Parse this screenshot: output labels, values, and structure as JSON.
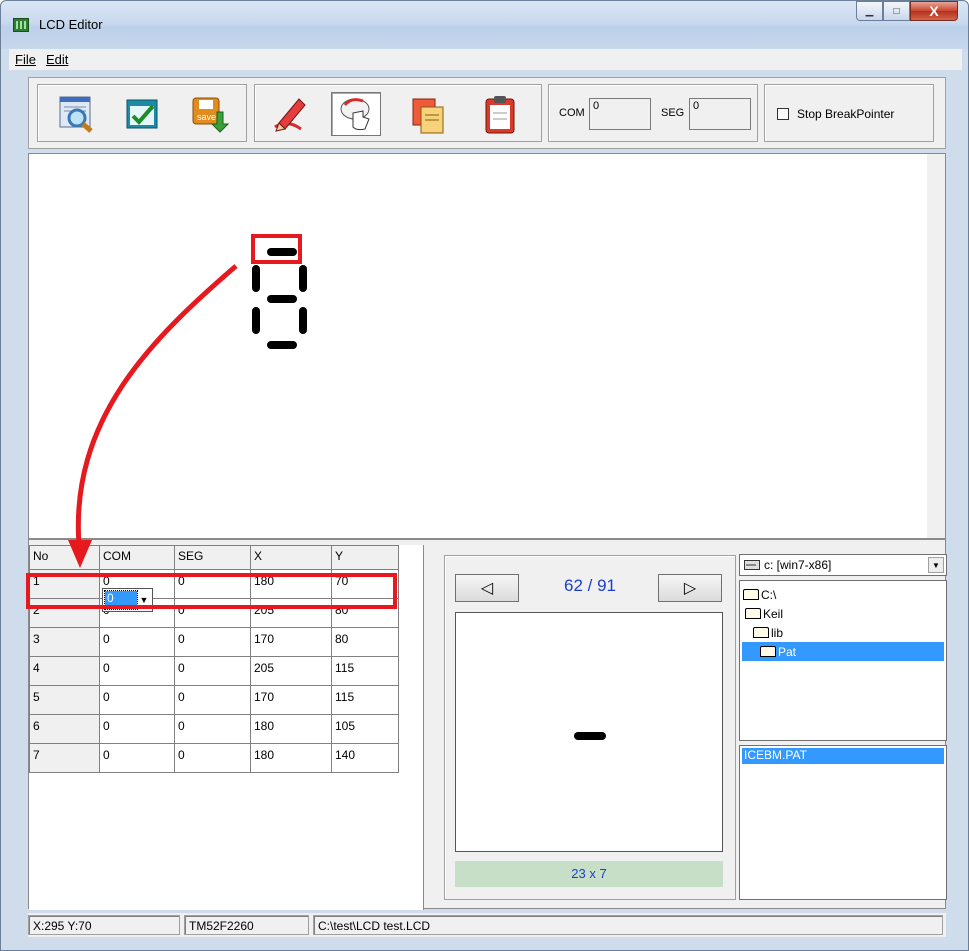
{
  "window": {
    "title": "LCD Editor",
    "min": "▁",
    "max": "□",
    "close": "X"
  },
  "menu": {
    "file": "File",
    "edit": "Edit"
  },
  "toolbar": {
    "com_label": "COM",
    "com_value": "0",
    "seg_label": "SEG",
    "seg_value": "0",
    "stop_breakpointer": "Stop BreakPointer",
    "stop_checked": false,
    "save_icon_text": "save"
  },
  "grid": {
    "headers": [
      "No",
      "COM",
      "SEG",
      "X",
      "Y"
    ],
    "rows": [
      [
        "1",
        "0",
        "0",
        "180",
        "70"
      ],
      [
        "2",
        "0",
        "0",
        "205",
        "80"
      ],
      [
        "3",
        "0",
        "0",
        "170",
        "80"
      ],
      [
        "4",
        "0",
        "0",
        "205",
        "115"
      ],
      [
        "5",
        "0",
        "0",
        "170",
        "115"
      ],
      [
        "6",
        "0",
        "0",
        "180",
        "105"
      ],
      [
        "7",
        "0",
        "0",
        "180",
        "140"
      ]
    ],
    "editing_value": "0"
  },
  "preview": {
    "page": "62 / 91",
    "size": "23 x 7",
    "prev": "◁",
    "next": "▷"
  },
  "files": {
    "drive": "c: [win7-x86]",
    "dirs": [
      "C:\\",
      "Keil",
      "lib",
      "Pat"
    ],
    "selected_dir": "Pat",
    "file": "ICEBM.PAT"
  },
  "status": {
    "coords": "X:295 Y:70",
    "chip": "TM52F2260",
    "path": "C:\\test\\LCD test.LCD"
  },
  "colors": {
    "accent": "#3399ff",
    "annotation": "#e5191e",
    "nav_text": "#1a3fcf"
  }
}
